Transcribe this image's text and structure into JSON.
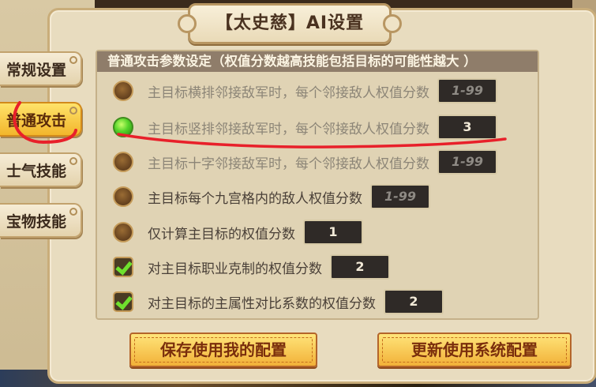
{
  "title": "【太史慈】AI设置",
  "tabs": [
    {
      "label": "常规设置",
      "active": false
    },
    {
      "label": "普通攻击",
      "active": true
    },
    {
      "label": "士气技能",
      "active": false
    },
    {
      "label": "宝物技能",
      "active": false
    }
  ],
  "section_header": "普通攻击参数设定（权值分数越高技能包括目标的可能性越大 ）",
  "options": [
    {
      "control": "radio",
      "selected": false,
      "label": "主目标横排邻接敌军时，每个邻接敌人权值分数",
      "value": "",
      "placeholder": "1-99"
    },
    {
      "control": "radio",
      "selected": true,
      "label": "主目标竖排邻接敌军时，每个邻接敌人权值分数",
      "value": "3",
      "placeholder": ""
    },
    {
      "control": "radio",
      "selected": false,
      "label": "主目标十字邻接敌军时，每个邻接敌人权值分数",
      "value": "",
      "placeholder": "1-99"
    },
    {
      "control": "radio",
      "selected": false,
      "label": "主目标每个九宫格内的敌人权值分数",
      "value": "",
      "placeholder": "1-99"
    },
    {
      "control": "radio",
      "selected": false,
      "label": "仅计算主目标的权值分数",
      "value": "1",
      "placeholder": ""
    },
    {
      "control": "checkbox",
      "checked": true,
      "label": "对主目标职业克制的权值分数",
      "value": "2",
      "placeholder": ""
    },
    {
      "control": "checkbox",
      "checked": true,
      "label": "对主目标的主属性对比系数的权值分数",
      "value": "2",
      "placeholder": ""
    }
  ],
  "buttons": {
    "save_mine": "保存使用我的配置",
    "use_system": "更新使用系统配置"
  },
  "colors": {
    "panel_bg": "#e8dcbf",
    "header_bg": "#8f7d6a",
    "active_tab": "#f2b62c",
    "button_gold": "#ffe57a",
    "annotation_red": "#e8202a"
  },
  "icons": {
    "selected_radio": "green-orb-icon",
    "unselected_radio": "brown-orb-icon",
    "checked": "green-checkmark-icon"
  }
}
